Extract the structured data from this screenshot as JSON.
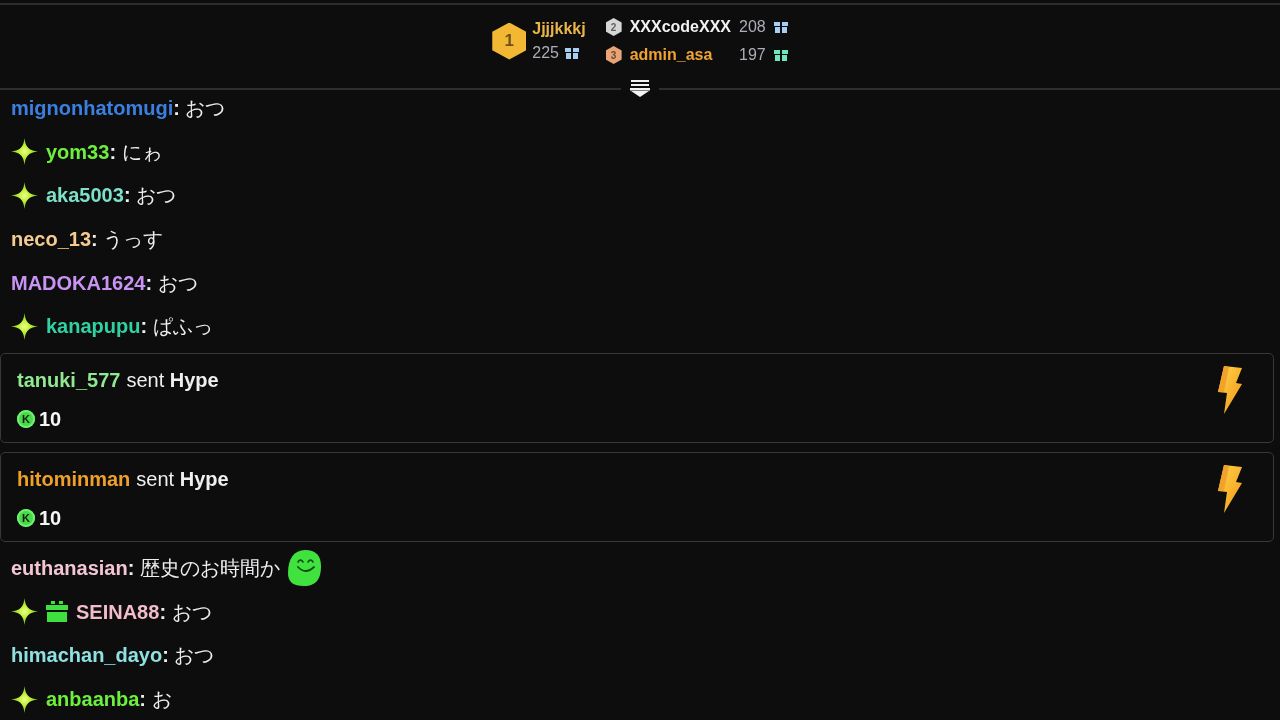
{
  "leaderboard": {
    "entries": [
      {
        "badge": {
          "rank": "1",
          "color": "#f2b833"
        },
        "name": "Jjjjkkkj",
        "color": "#e9b448",
        "gift": {
          "count": "225",
          "color": "#a8cdf2"
        }
      },
      {
        "badge": {
          "rank": "2",
          "color": "#d6d6d6"
        },
        "name": "XXXcodeXXX",
        "color": "#f2f2f2",
        "gift": {
          "count": "208",
          "color": "#a8cdf2"
        }
      },
      {
        "badge": {
          "rank": "3",
          "color": "#e8a474"
        },
        "name": "admin_asa",
        "color": "#f0a332",
        "gift": {
          "count": "197",
          "color": "#6fe6c0"
        }
      }
    ]
  },
  "messages": [
    {
      "kind": "chat",
      "user": "mignonhatomugi",
      "color": "#3b7fe0",
      "text": "**:** おつ"
    },
    {
      "kind": "chat",
      "badges": [
        {
          "kind": "sparkle"
        }
      ],
      "user": "yom33",
      "color": "#6cf03c",
      "text": "**:** にゎ"
    },
    {
      "kind": "chat",
      "badges": [
        {
          "kind": "sparkle"
        }
      ],
      "user": "aka5003",
      "color": "#7de0c8",
      "text": "**:** おつ"
    },
    {
      "kind": "chat",
      "user": "neco_13",
      "color": "#f5cb90",
      "text": "**:** うっす"
    },
    {
      "kind": "chat",
      "user": "MADOKA1624",
      "color": "#c894f4",
      "text": "**:** おつ"
    },
    {
      "kind": "chat",
      "badges": [
        {
          "kind": "sparkle"
        }
      ],
      "user": "kanapupu",
      "color": "#2fd2a2",
      "text": "**:** ぱふっ"
    },
    {
      "kind": "hype",
      "user": "tanuki_577",
      "color": "#90e890",
      "event": "sent **Hype**",
      "coin": "K",
      "amount": "10"
    },
    {
      "kind": "hype",
      "user": "hitominman",
      "color": "#f0a028",
      "event": "sent **Hype**",
      "coin": "K",
      "amount": "10"
    },
    {
      "kind": "chat",
      "user": "euthanasian",
      "color": "#f2c6d2",
      "text": "**:** 歴史のお時間か",
      "emotes": [
        {
          "kind": "blob"
        }
      ]
    },
    {
      "kind": "chat",
      "badges": [
        {
          "kind": "sparkle"
        },
        {
          "kind": "gift"
        }
      ],
      "user": "SEINA88",
      "color": "#f2bccb",
      "text": "**:** おつ"
    },
    {
      "kind": "chat",
      "user": "himachan_dayo",
      "color": "#8fe0e0",
      "text": "**:** おつ"
    },
    {
      "kind": "chat",
      "badges": [
        {
          "kind": "sparkle"
        }
      ],
      "user": "anbaanba",
      "color": "#6cf03c",
      "text": "**:** お"
    }
  ]
}
